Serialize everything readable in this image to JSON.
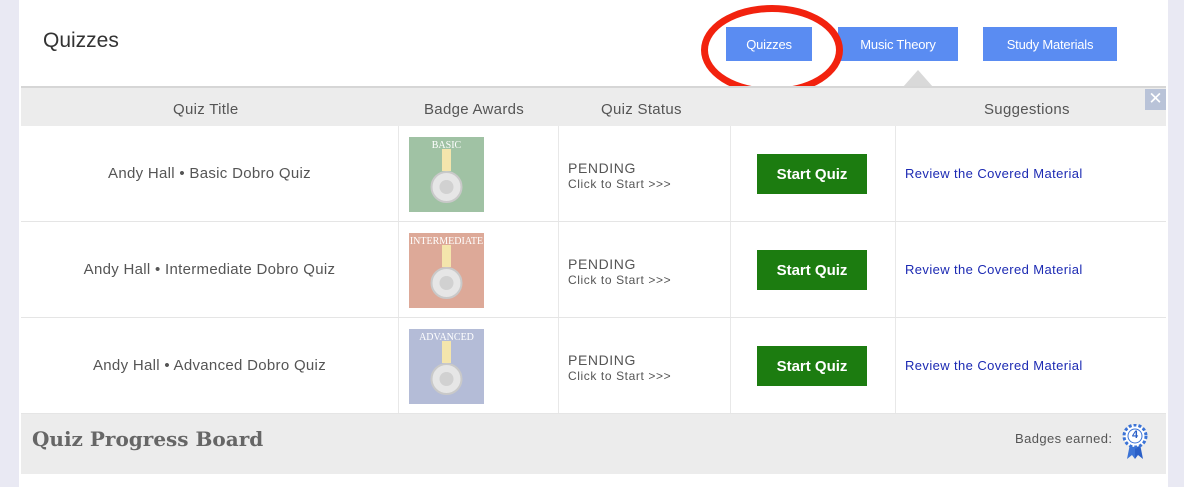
{
  "header": {
    "title": "Quizzes",
    "nav": [
      {
        "label": "Quizzes"
      },
      {
        "label": "Music Theory"
      },
      {
        "label": "Study Materials"
      }
    ]
  },
  "table": {
    "close_glyph": "✕",
    "columns": [
      "Quiz Title",
      "Badge Awards",
      "Quiz Status",
      "Suggestions"
    ],
    "rows": [
      {
        "title": "Andy Hall • Basic Dobro Quiz",
        "badge_label": "BASIC",
        "badge_color": "#2f7a38",
        "status": "PENDING",
        "status_sub": "Click to Start >>>",
        "action": "Start Quiz",
        "suggestion": "Review the Covered Material"
      },
      {
        "title": "Andy Hall • Intermediate Dobro Quiz",
        "badge_label": "INTERMEDIATE",
        "badge_color": "#b5431c",
        "status": "PENDING",
        "status_sub": "Click to Start >>>",
        "action": "Start Quiz",
        "suggestion": "Review the Covered Material"
      },
      {
        "title": "Andy Hall • Advanced Dobro Quiz",
        "badge_label": "ADVANCED",
        "badge_color": "#5a6ca8",
        "status": "PENDING",
        "status_sub": "Click to Start >>>",
        "action": "Start Quiz",
        "suggestion": "Review the Covered Material"
      }
    ]
  },
  "progress": {
    "title": "Quiz Progress Board",
    "badges_label": "Badges earned:",
    "badges_count": "4",
    "ribbon_icon": "award-ribbon-icon"
  },
  "colors": {
    "nav_button": "#5a8cf2",
    "start_button": "#1c7c10",
    "highlight_ring": "#f2220e",
    "link": "#1c2ab3"
  }
}
